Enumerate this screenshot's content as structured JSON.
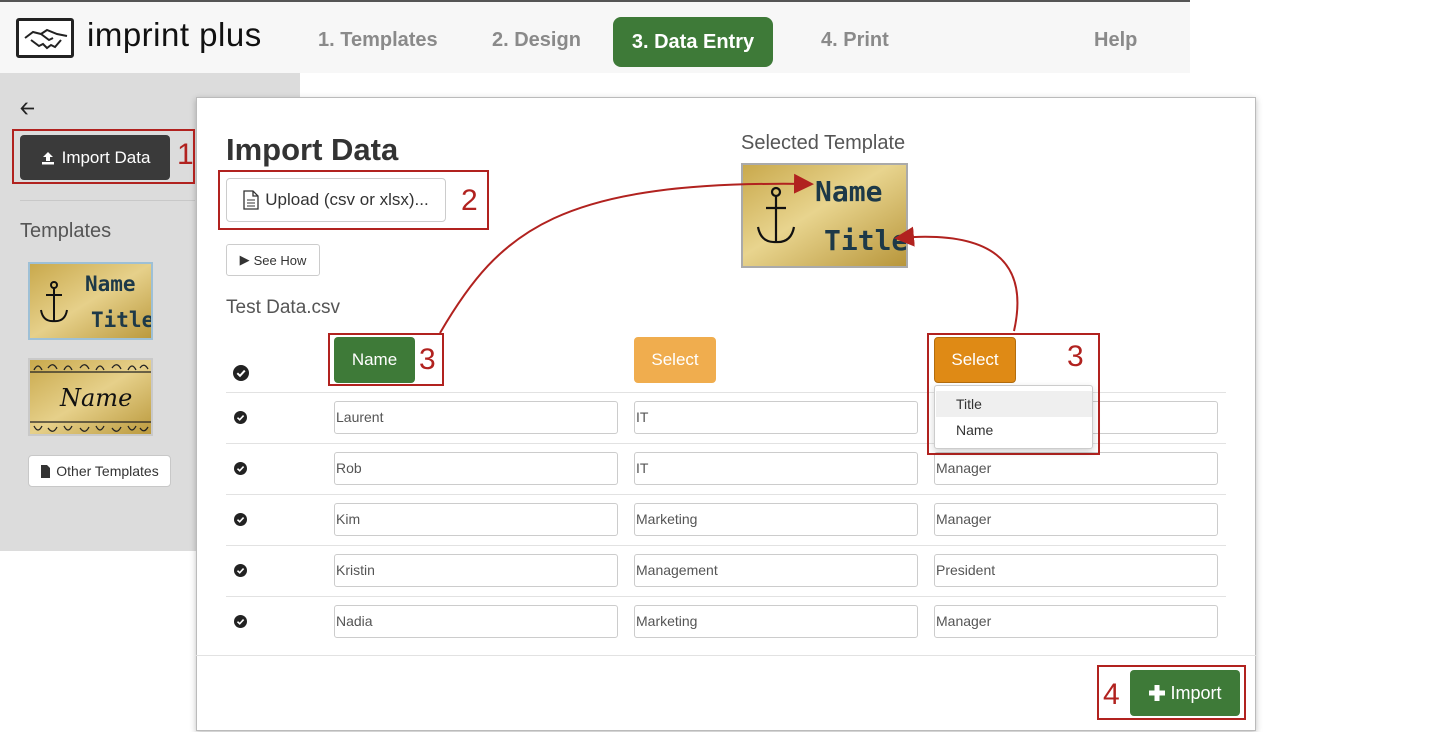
{
  "app": {
    "brand": "imprint plus"
  },
  "nav": {
    "items": [
      "1. Templates",
      "2. Design",
      "3. Data Entry",
      "4. Print"
    ],
    "help": "Help",
    "active_color": "#3e7a38"
  },
  "sidebar": {
    "import_data": "Import Data",
    "templates_heading": "Templates",
    "tpl1_line1": "Name",
    "tpl1_line2": "Title",
    "tpl2_line1": "Name",
    "other_templates": "Other Templates"
  },
  "modal": {
    "title": "Import Data",
    "upload": "Upload (csv or xlsx)...",
    "see_how": "See How",
    "file_name": "Test Data.csv",
    "selected_template_label": "Selected Template",
    "selected_line1": "Name",
    "selected_line2": "Title",
    "columns": [
      "Name",
      "Select",
      "Select"
    ],
    "dropdown": [
      "Title",
      "Name"
    ],
    "rows": [
      [
        "Laurent",
        "IT",
        ""
      ],
      [
        "Rob",
        "IT",
        "Manager"
      ],
      [
        "Kim",
        "Marketing",
        "Manager"
      ],
      [
        "Kristin",
        "Management",
        "President"
      ],
      [
        "Nadia",
        "Marketing",
        "Manager"
      ]
    ],
    "import_button": "Import"
  },
  "callouts": {
    "n1": "1",
    "n2": "2",
    "n3a": "3",
    "n3b": "3",
    "n4": "4",
    "color": "#b1221f"
  }
}
